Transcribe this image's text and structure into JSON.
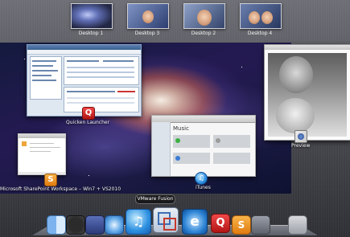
{
  "spaces": [
    {
      "label": "Desktop 1"
    },
    {
      "label": "Desktop 3"
    },
    {
      "label": "Desktop 2"
    },
    {
      "label": "Desktop 4"
    }
  ],
  "windows": {
    "quicken_label": "Quicken Launcher",
    "sharepoint_label": "Microsoft SharePoint Workspace – Win7 + VS2010",
    "itunes_label": "iTunes",
    "itunes_heading": "Music",
    "preview_label": "Preview"
  },
  "dock": {
    "tooltip": "VMware Fusion",
    "items": [
      "Finder",
      "Dashboard",
      "Mission Control",
      "Safari",
      "iTunes",
      "VMware Fusion",
      "Internet Explorer",
      "Quicken",
      "SharePoint Workspace",
      "Utilities",
      "Trash"
    ]
  },
  "colors": {
    "accent_quicken": "#c81e1e",
    "accent_itunes": "#2b8fe0",
    "accent_sharepoint": "#f08a1c"
  }
}
